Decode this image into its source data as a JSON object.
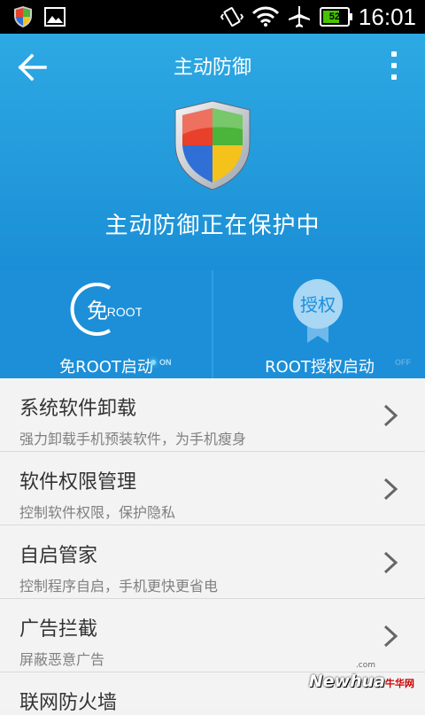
{
  "statusbar": {
    "time": "16:01",
    "battery": "52",
    "icons": [
      "shield-app-icon",
      "image-icon",
      "vibrate-icon",
      "wifi-icon",
      "airplane-icon",
      "battery-icon"
    ]
  },
  "header": {
    "title": "主动防御",
    "back_icon": "arrow-left-icon",
    "menu_icon": "overflow-menu-icon"
  },
  "hero": {
    "status_text": "主动防御正在保护中",
    "shield_colors": [
      "#e8402a",
      "#4bb43a",
      "#2f6fd6",
      "#f4c21b"
    ]
  },
  "cards": [
    {
      "label": "免ROOT启动",
      "toggle": "ON",
      "icon_glyph": "免",
      "icon_sub": "ROOT"
    },
    {
      "label": "ROOT授权启动",
      "toggle": "OFF",
      "icon_glyph": "授权"
    }
  ],
  "list": [
    {
      "title": "系统软件卸载",
      "subtitle": "强力卸载手机预装软件，为手机瘦身"
    },
    {
      "title": "软件权限管理",
      "subtitle": "控制软件权限，保护隐私"
    },
    {
      "title": "自启管家",
      "subtitle": "控制程序自启，手机更快更省电"
    },
    {
      "title": "广告拦截",
      "subtitle": "屏蔽恶意广告"
    },
    {
      "title": "联网防火墙",
      "subtitle": ""
    }
  ],
  "watermark": {
    "text": "Newhua",
    "domain": ".com",
    "cn": "牛华网"
  },
  "colors": {
    "accent": "#1c8fd8",
    "hero_top": "#2da9e3"
  }
}
